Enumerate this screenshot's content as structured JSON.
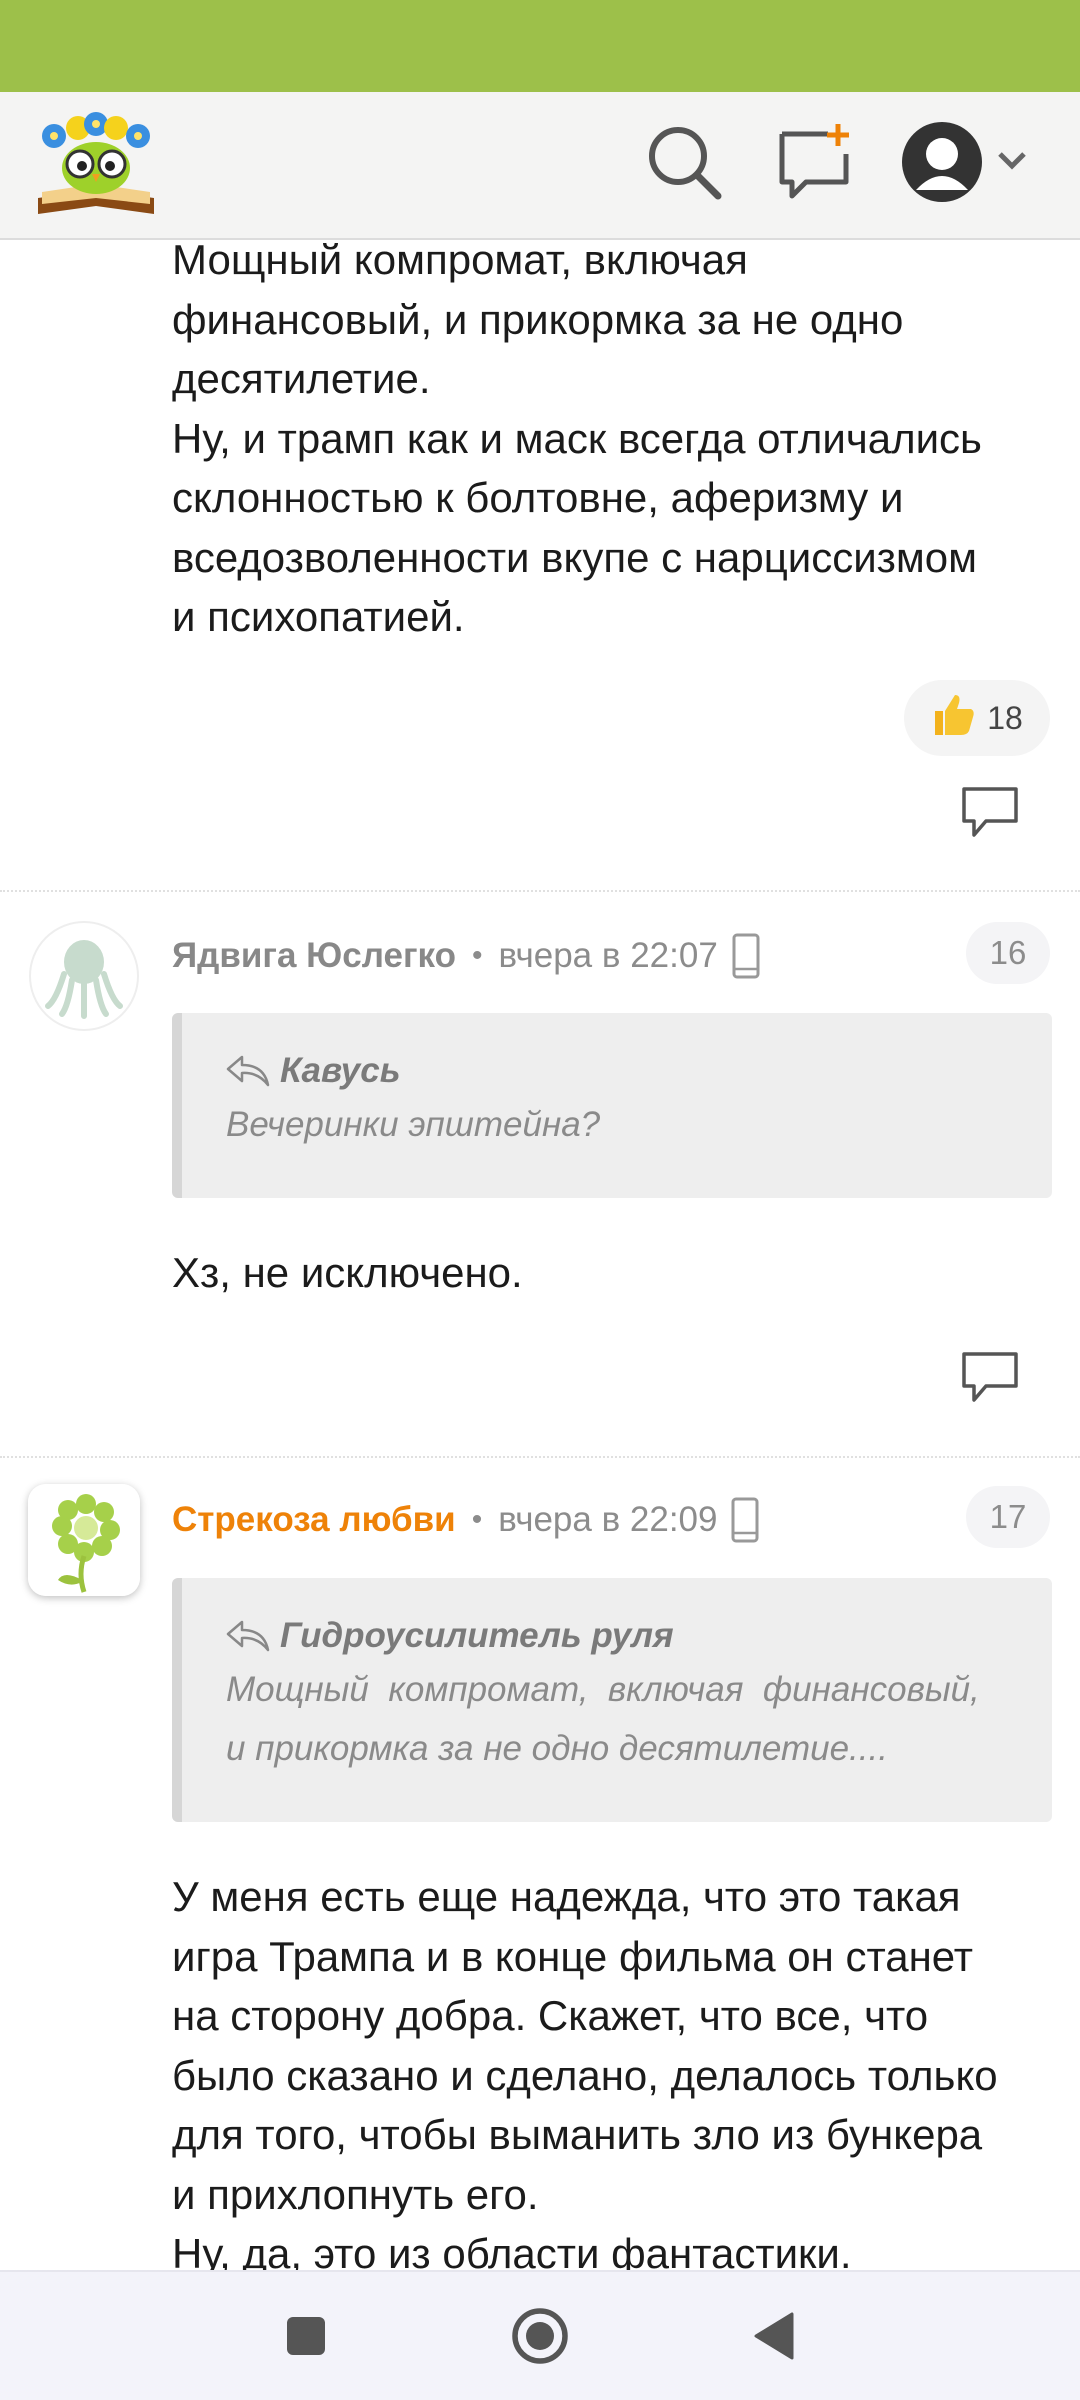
{
  "header": {
    "logo_icon": "owl-book-logo-icon",
    "search_icon": "search-icon",
    "new_post_icon": "new-message-icon",
    "profile_icon": "user-avatar-icon",
    "accent_color": "#9dc04a",
    "brand_orange": "#ee8208"
  },
  "comments": [
    {
      "text_lines": [
        "Мощный компромат, включая",
        "финансовый, и прикормка за не одно",
        "десятилетие.",
        "Ну, и трамп как и маск всегда отличались",
        "склонностью к болтовне, аферизму и",
        "вседозволенности вкупе с нарциссизмом",
        "и психопатией."
      ],
      "likes": "18"
    },
    {
      "author": "Ядвига Юслегко",
      "separator": "•",
      "time": "вчера в 22:07",
      "number": "16",
      "quote_author": "Кавусь",
      "quote_lines": [
        "Вечеринки эпштейна?"
      ],
      "text_lines": [
        "Хз, не исключено."
      ]
    },
    {
      "author": "Стрекоза любви",
      "separator": "•",
      "time": "вчера в 22:09",
      "number": "17",
      "quote_author": "Гидроусилитель руля",
      "quote_lines": [
        "Мощный  компромат,  включая  финансовый,",
        "и прикормка за не одно десятилетие...."
      ],
      "text_lines": [
        "У меня есть еще надежда, что это такая",
        "игра Трампа и в конце фильма он станет",
        "на сторону добра. Скажет, что все, что",
        "было сказано и сделано, делалось только",
        "для того, чтобы выманить зло из бункера",
        "и прихлопнуть его.",
        "Ну, да, это из области фантастики."
      ]
    }
  ],
  "nav": {
    "recents_icon": "square-recents-icon",
    "home_icon": "circle-home-icon",
    "back_icon": "triangle-back-icon"
  }
}
